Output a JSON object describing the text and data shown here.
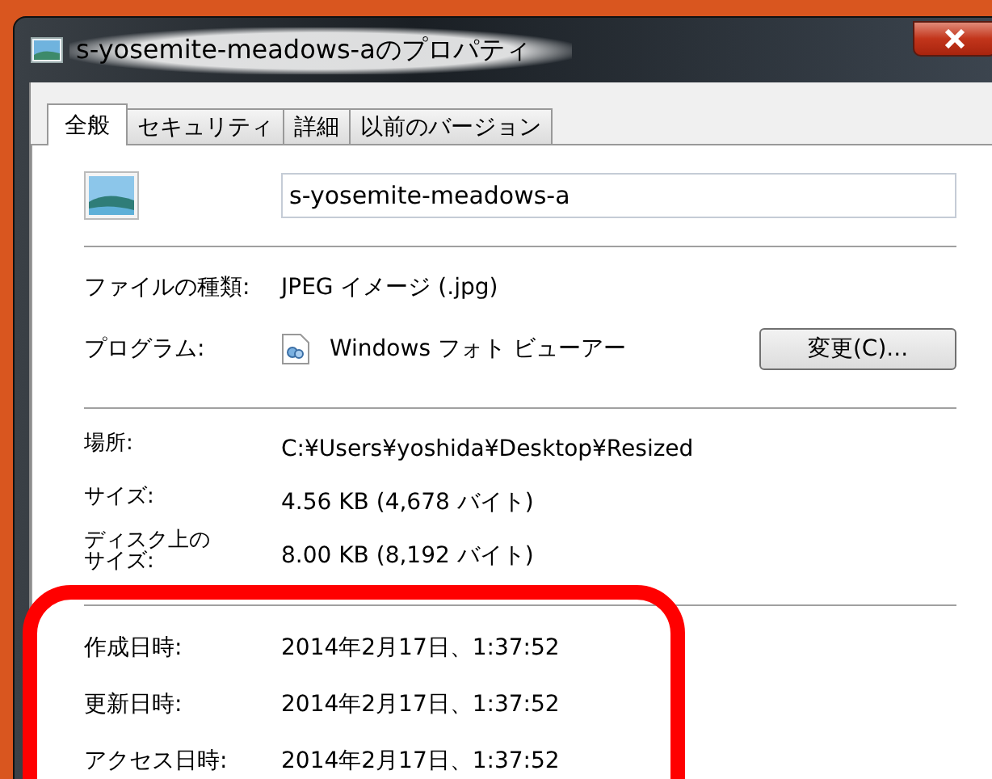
{
  "window": {
    "title": "s-yosemite-meadows-aのプロパティ"
  },
  "tabs": [
    {
      "label": "全般",
      "selected": true
    },
    {
      "label": "セキュリティ",
      "selected": false
    },
    {
      "label": "詳細",
      "selected": false
    },
    {
      "label": "以前のバージョン",
      "selected": false
    }
  ],
  "file_name": {
    "value": "s-yosemite-meadows-a"
  },
  "type_row": {
    "label": "ファイルの種類:",
    "value": "JPEG イメージ (.jpg)"
  },
  "program_row": {
    "label": "プログラム:",
    "value": "Windows フォト ビューアー",
    "button": "変更(C)..."
  },
  "info_rows": [
    {
      "label": "場所:",
      "value": "C:¥Users¥yoshida¥Desktop¥Resized"
    },
    {
      "label": "サイズ:",
      "value": "4.56 KB (4,678 バイト)"
    },
    {
      "label": "ディスク上のサイズ:",
      "value": "8.00 KB (8,192 バイト)"
    }
  ],
  "date_rows": [
    {
      "label": "作成日時:",
      "value": "2014年2月17日、1:37:52"
    },
    {
      "label": "更新日時:",
      "value": "2014年2月17日、1:37:52"
    },
    {
      "label": "アクセス日時:",
      "value": "2014年2月17日、1:37:52"
    }
  ]
}
